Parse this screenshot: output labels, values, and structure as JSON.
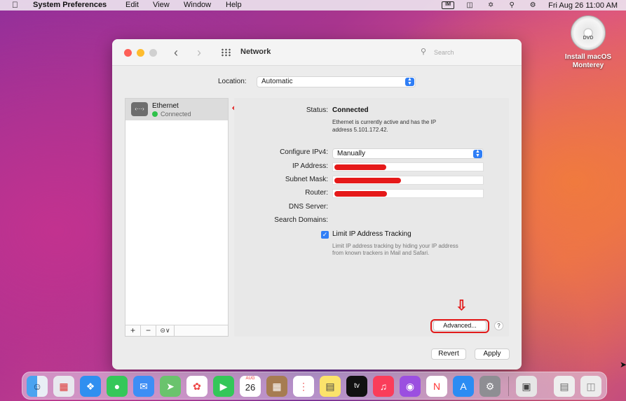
{
  "menubar": {
    "app_name": "System Preferences",
    "menus": [
      "Edit",
      "View",
      "Window",
      "Help"
    ],
    "clock": "Fri Aug 26  11:00 AM"
  },
  "desktop": {
    "disc_label": "DVD",
    "icon_label_line1": "Install macOS",
    "icon_label_line2": "Monterey"
  },
  "window": {
    "title": "Network",
    "search_placeholder": "Search",
    "location_label": "Location:",
    "location_value": "Automatic"
  },
  "sidebar": {
    "services": [
      {
        "name": "Ethernet",
        "status": "Connected",
        "icon": "ethernet-icon",
        "icon_glyph": "‹···›",
        "status_color": "#2ec24a"
      }
    ],
    "buttons": {
      "add": "+",
      "remove": "−",
      "action": "⊝∨"
    }
  },
  "detail": {
    "status_label": "Status:",
    "status_value": "Connected",
    "status_desc_line1": "Ethernet is currently active and has the IP",
    "status_desc_line2": "address 5.101.172.42.",
    "configure_label": "Configure IPv4:",
    "configure_value": "Manually",
    "ip_label": "IP Address:",
    "subnet_label": "Subnet Mask:",
    "router_label": "Router:",
    "dns_label": "DNS Server:",
    "search_domains_label": "Search Domains:",
    "limit_tracking_label": "Limit IP Address Tracking",
    "limit_tracking_checked": true,
    "limit_desc_line1": "Limit IP address tracking by hiding your IP address",
    "limit_desc_line2": "from known trackers in Mail and Safari.",
    "advanced_label": "Advanced...",
    "help_label": "?",
    "revert_label": "Revert",
    "apply_label": "Apply"
  },
  "colors": {
    "accent": "#2f7ef6",
    "annotation_red": "#e21b1b",
    "redaction": "#e51919"
  },
  "dock": {
    "calendar_month": "AUG",
    "calendar_day": "26",
    "apps": [
      "finder-icon",
      "launchpad-icon",
      "safari-icon",
      "messages-icon",
      "mail-icon",
      "maps-icon",
      "photos-icon",
      "facetime-icon",
      "calendar-icon",
      "notes-app-icon",
      "reminders-icon",
      "notes-icon",
      "apple-tv-icon",
      "music-icon",
      "podcasts-icon",
      "news-icon",
      "app-store-icon",
      "system-preferences-icon",
      "preview-icon",
      "documents-icon",
      "trash-icon"
    ]
  }
}
